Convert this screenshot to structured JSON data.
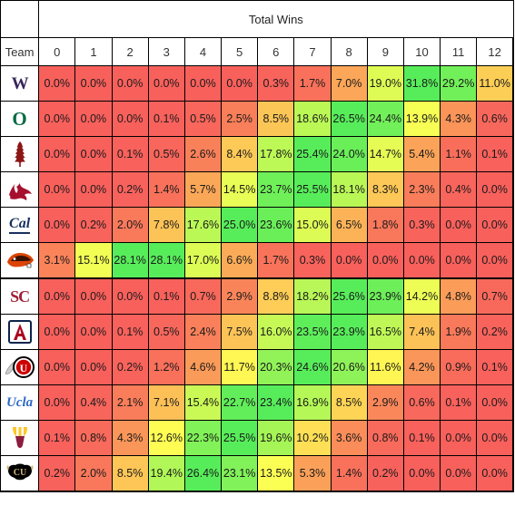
{
  "table": {
    "super_header": "Total Wins",
    "team_header": "Team",
    "columns": [
      "0",
      "1",
      "2",
      "3",
      "4",
      "5",
      "6",
      "7",
      "8",
      "9",
      "10",
      "11",
      "12"
    ]
  },
  "colors": {
    "low": "#F8605C",
    "mid": "#FFFF54",
    "high": "#57ED5A",
    "grid_line": "#000000",
    "background": "#FFFFFF",
    "text": "#1A1A1A"
  },
  "rows": [
    {
      "team": "Washington",
      "logo": "washington-w-logo",
      "division": "north",
      "values": [
        "0.0%",
        "0.0%",
        "0.0%",
        "0.0%",
        "0.0%",
        "0.0%",
        "0.3%",
        "1.7%",
        "7.0%",
        "19.0%",
        "31.8%",
        "29.2%",
        "11.0%"
      ]
    },
    {
      "team": "Oregon",
      "logo": "oregon-o-logo",
      "division": "north",
      "values": [
        "0.0%",
        "0.0%",
        "0.0%",
        "0.1%",
        "0.5%",
        "2.5%",
        "8.5%",
        "18.6%",
        "26.5%",
        "24.4%",
        "13.9%",
        "4.3%",
        "0.6%"
      ]
    },
    {
      "team": "Stanford",
      "logo": "stanford-tree-logo",
      "division": "north",
      "values": [
        "0.0%",
        "0.0%",
        "0.1%",
        "0.5%",
        "2.6%",
        "8.4%",
        "17.8%",
        "25.4%",
        "24.0%",
        "14.7%",
        "5.4%",
        "1.1%",
        "0.1%"
      ]
    },
    {
      "team": "Washington State",
      "logo": "washington-state-cougar-logo",
      "division": "north",
      "values": [
        "0.0%",
        "0.0%",
        "0.2%",
        "1.4%",
        "5.7%",
        "14.5%",
        "23.7%",
        "25.5%",
        "18.1%",
        "8.3%",
        "2.3%",
        "0.4%",
        "0.0%"
      ]
    },
    {
      "team": "California",
      "logo": "cal-script-logo",
      "division": "north",
      "values": [
        "0.0%",
        "0.2%",
        "2.0%",
        "7.8%",
        "17.6%",
        "25.0%",
        "23.6%",
        "15.0%",
        "6.5%",
        "1.8%",
        "0.3%",
        "0.0%",
        "0.0%"
      ]
    },
    {
      "team": "Oregon State",
      "logo": "oregon-state-beaver-logo",
      "division": "north",
      "values": [
        "3.1%",
        "15.1%",
        "28.1%",
        "28.1%",
        "17.0%",
        "6.6%",
        "1.7%",
        "0.3%",
        "0.0%",
        "0.0%",
        "0.0%",
        "0.0%",
        "0.0%"
      ]
    },
    {
      "team": "USC",
      "logo": "usc-sc-logo",
      "division": "south",
      "values": [
        "0.0%",
        "0.0%",
        "0.0%",
        "0.1%",
        "0.7%",
        "2.9%",
        "8.8%",
        "18.2%",
        "25.6%",
        "23.9%",
        "14.2%",
        "4.8%",
        "0.7%"
      ]
    },
    {
      "team": "Arizona",
      "logo": "arizona-block-a-logo",
      "division": "south",
      "values": [
        "0.0%",
        "0.0%",
        "0.1%",
        "0.5%",
        "2.4%",
        "7.5%",
        "16.0%",
        "23.5%",
        "23.9%",
        "16.5%",
        "7.4%",
        "1.9%",
        "0.2%"
      ]
    },
    {
      "team": "Utah",
      "logo": "utah-drum-feather-logo",
      "division": "south",
      "values": [
        "0.0%",
        "0.0%",
        "0.2%",
        "1.2%",
        "4.6%",
        "11.7%",
        "20.3%",
        "24.6%",
        "20.6%",
        "11.6%",
        "4.2%",
        "0.9%",
        "0.1%"
      ]
    },
    {
      "team": "UCLA",
      "logo": "ucla-script-logo",
      "division": "south",
      "values": [
        "0.0%",
        "0.4%",
        "2.1%",
        "7.1%",
        "15.4%",
        "22.7%",
        "23.4%",
        "16.9%",
        "8.5%",
        "2.9%",
        "0.6%",
        "0.1%",
        "0.0%"
      ]
    },
    {
      "team": "Arizona State",
      "logo": "arizona-state-pitchfork-logo",
      "division": "south",
      "values": [
        "0.1%",
        "0.8%",
        "4.3%",
        "12.6%",
        "22.3%",
        "25.5%",
        "19.6%",
        "10.2%",
        "3.6%",
        "0.8%",
        "0.1%",
        "0.0%",
        "0.0%"
      ]
    },
    {
      "team": "Colorado",
      "logo": "colorado-buffalo-logo",
      "division": "south",
      "values": [
        "0.2%",
        "2.0%",
        "8.5%",
        "19.4%",
        "26.4%",
        "23.1%",
        "13.5%",
        "5.3%",
        "1.4%",
        "0.2%",
        "0.0%",
        "0.0%",
        "0.0%"
      ]
    }
  ],
  "chart_data": {
    "type": "heatmap",
    "title": "Total Wins",
    "xlabel": "Total Wins",
    "ylabel": "Team",
    "categories": [
      "0",
      "1",
      "2",
      "3",
      "4",
      "5",
      "6",
      "7",
      "8",
      "9",
      "10",
      "11",
      "12"
    ],
    "row_labels": [
      "Washington",
      "Oregon",
      "Stanford",
      "Washington State",
      "California",
      "Oregon State",
      "USC",
      "Arizona",
      "Utah",
      "UCLA",
      "Arizona State",
      "Colorado"
    ],
    "unit": "percent",
    "color_scale": "per-row red-yellow-green",
    "grid": true,
    "legend": "none",
    "series": [
      {
        "name": "Washington",
        "values": [
          0.0,
          0.0,
          0.0,
          0.0,
          0.0,
          0.0,
          0.3,
          1.7,
          7.0,
          19.0,
          31.8,
          29.2,
          11.0
        ]
      },
      {
        "name": "Oregon",
        "values": [
          0.0,
          0.0,
          0.0,
          0.1,
          0.5,
          2.5,
          8.5,
          18.6,
          26.5,
          24.4,
          13.9,
          4.3,
          0.6
        ]
      },
      {
        "name": "Stanford",
        "values": [
          0.0,
          0.0,
          0.1,
          0.5,
          2.6,
          8.4,
          17.8,
          25.4,
          24.0,
          14.7,
          5.4,
          1.1,
          0.1
        ]
      },
      {
        "name": "Washington State",
        "values": [
          0.0,
          0.0,
          0.2,
          1.4,
          5.7,
          14.5,
          23.7,
          25.5,
          18.1,
          8.3,
          2.3,
          0.4,
          0.0
        ]
      },
      {
        "name": "California",
        "values": [
          0.0,
          0.2,
          2.0,
          7.8,
          17.6,
          25.0,
          23.6,
          15.0,
          6.5,
          1.8,
          0.3,
          0.0,
          0.0
        ]
      },
      {
        "name": "Oregon State",
        "values": [
          3.1,
          15.1,
          28.1,
          28.1,
          17.0,
          6.6,
          1.7,
          0.3,
          0.0,
          0.0,
          0.0,
          0.0,
          0.0
        ]
      },
      {
        "name": "USC",
        "values": [
          0.0,
          0.0,
          0.0,
          0.1,
          0.7,
          2.9,
          8.8,
          18.2,
          25.6,
          23.9,
          14.2,
          4.8,
          0.7
        ]
      },
      {
        "name": "Arizona",
        "values": [
          0.0,
          0.0,
          0.1,
          0.5,
          2.4,
          7.5,
          16.0,
          23.5,
          23.9,
          16.5,
          7.4,
          1.9,
          0.2
        ]
      },
      {
        "name": "Utah",
        "values": [
          0.0,
          0.0,
          0.2,
          1.2,
          4.6,
          11.7,
          20.3,
          24.6,
          20.6,
          11.6,
          4.2,
          0.9,
          0.1
        ]
      },
      {
        "name": "UCLA",
        "values": [
          0.0,
          0.4,
          2.1,
          7.1,
          15.4,
          22.7,
          23.4,
          16.9,
          8.5,
          2.9,
          0.6,
          0.1,
          0.0
        ]
      },
      {
        "name": "Arizona State",
        "values": [
          0.1,
          0.8,
          4.3,
          12.6,
          22.3,
          25.5,
          19.6,
          10.2,
          3.6,
          0.8,
          0.1,
          0.0,
          0.0
        ]
      },
      {
        "name": "Colorado",
        "values": [
          0.2,
          2.0,
          8.5,
          19.4,
          26.4,
          23.1,
          13.5,
          5.3,
          1.4,
          0.2,
          0.0,
          0.0,
          0.0
        ]
      }
    ]
  }
}
